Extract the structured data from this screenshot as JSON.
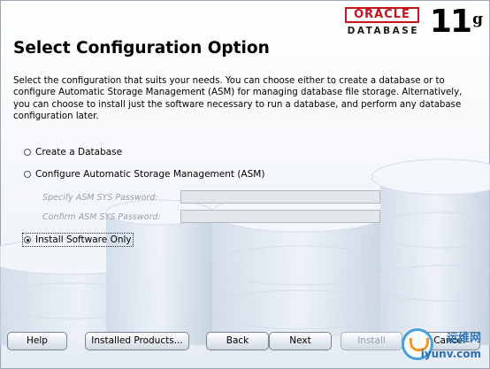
{
  "brand": {
    "oracle": "ORACLE",
    "database": "DATABASE",
    "version_num": "11",
    "version_suffix": "g"
  },
  "page": {
    "title": "Select Configuration Option",
    "description": "Select the configuration that suits your needs. You can choose either to create a database or to configure Automatic Storage Management (ASM) for managing database file storage. Alternatively, you can choose to install just the software necessary to run a database, and perform any database configuration later."
  },
  "options": [
    {
      "label": "Create a Database",
      "selected": false
    },
    {
      "label": "Configure Automatic Storage Management (ASM)",
      "selected": false
    },
    {
      "label": "Install Software Only",
      "selected": true
    }
  ],
  "asm": {
    "sys_password_label": "Specify ASM SYS Password:",
    "sys_password_value": "",
    "confirm_password_label": "Confirm ASM SYS Password:",
    "confirm_password_value": ""
  },
  "buttons": {
    "help": "Help",
    "installed_products": "Installed Products...",
    "back": "Back",
    "next": "Next",
    "install": "Install",
    "cancel": "Cancel"
  },
  "watermark": {
    "site_cn": "运维网",
    "site_url": "iyunv.com"
  },
  "colors": {
    "oracle_red": "#c4161c",
    "watermark_blue": "#2a6fb0"
  }
}
